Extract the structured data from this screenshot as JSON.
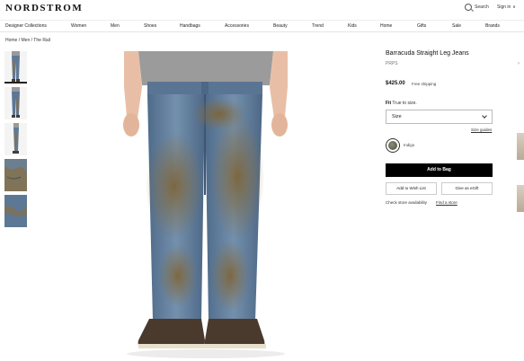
{
  "brand_logo": "NORDSTROM",
  "header": {
    "search_label": "Search",
    "signin_label": "Sign in",
    "signin_caret": "∨"
  },
  "nav": [
    "Designer Collections",
    "Women",
    "Men",
    "Shoes",
    "Handbags",
    "Accessories",
    "Beauty",
    "Trend",
    "Kids",
    "Home",
    "Gifts",
    "Sale",
    "Brands"
  ],
  "breadcrumb": "Home  /  Men  /  The Rail",
  "product": {
    "title": "Barracuda Straight Leg Jeans",
    "brand": "PRPS",
    "price": "$425.00",
    "shipping": "Free shipping",
    "fit_label": "Fit",
    "fit_value": "True to size.",
    "size_placeholder": "Size",
    "size_guides": "Size guides",
    "color_name": "Indigo",
    "add_to_bag": "Add to Bag",
    "wish_list": "Add to Wish List",
    "egift": "Give as eGift",
    "store_availability": "Check store availability",
    "find_store": "Find a store"
  },
  "colors": {
    "accent": "#000000",
    "denim": "#5f7a98",
    "mud": "#8a6e3e",
    "shirt": "#9a9a9a",
    "boot": "#4a3a2e"
  },
  "icons": {
    "search": "search-icon",
    "chevron": "chevron-down-icon",
    "next": "chevron-right-icon"
  }
}
